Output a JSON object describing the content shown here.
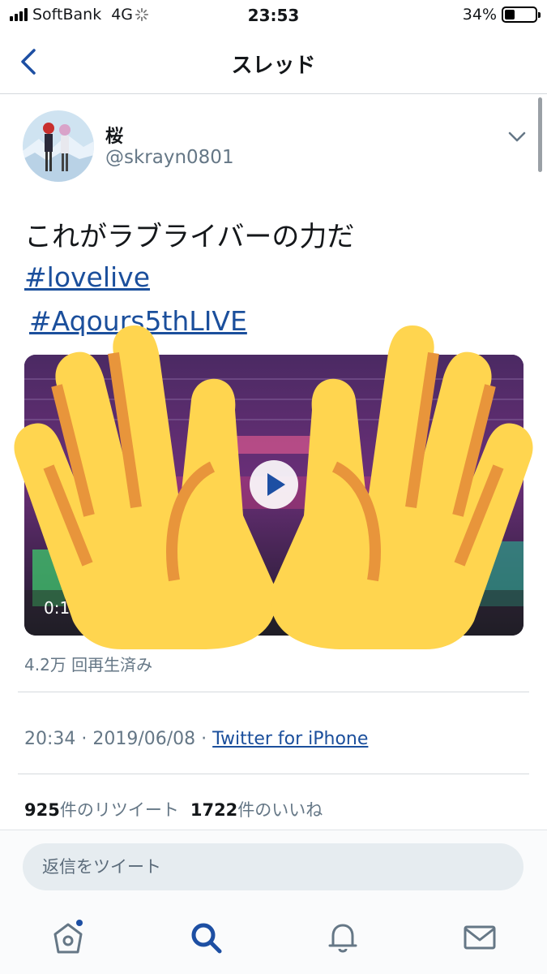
{
  "status_bar": {
    "carrier": "SoftBank",
    "network": "4G",
    "time": "23:53",
    "battery_percent": "34%",
    "battery_level": 0.34
  },
  "nav": {
    "title": "スレッド",
    "back_icon": "chevron-left-icon"
  },
  "tweet": {
    "author_name": "桜",
    "author_handle": "@skrayn0801",
    "text": "これがラブライバーの力だ",
    "hashtags": [
      "#lovelive",
      "#Aqours5thLIVE"
    ],
    "media": {
      "duration": "0:10",
      "views": "4.2万 回再生済み"
    },
    "timestamp": "20:34 · 2019/06/08 · ",
    "source": "Twitter for iPhone",
    "retweet_count": "925",
    "retweet_label": "件のリツイート",
    "like_count": "1722",
    "like_label": "件のいいね"
  },
  "reply": {
    "placeholder": "返信をツイート"
  },
  "tabs": [
    "home-icon",
    "search-icon",
    "bell-icon",
    "mail-icon"
  ],
  "colors": {
    "accent": "#1b4f9c",
    "tab_active": "#1d4fa3",
    "secondary_text": "#657786",
    "hand_fill": "#ffd54f",
    "hand_stroke": "#e8953b"
  }
}
